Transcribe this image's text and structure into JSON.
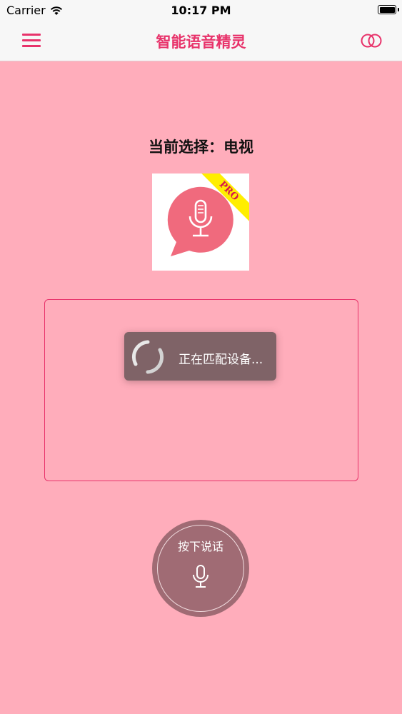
{
  "status_bar": {
    "carrier": "Carrier",
    "time": "10:17 PM",
    "icons": [
      "wifi-icon",
      "battery-icon"
    ]
  },
  "nav": {
    "title": "智能语音精灵",
    "left_icon": "menu-icon",
    "right_icon": "rings-icon"
  },
  "main": {
    "selection_text": "当前选择：电视",
    "logo_badge": "PRO",
    "loading_text": "正在匹配设备...",
    "talk_button_label": "按下说话"
  },
  "colors": {
    "accent": "#e8336b",
    "background": "#ffadbb",
    "hud": "#745c60",
    "talk_button": "#a06b74",
    "logo_circle": "#f06a7d",
    "ribbon": "#ffee00"
  }
}
